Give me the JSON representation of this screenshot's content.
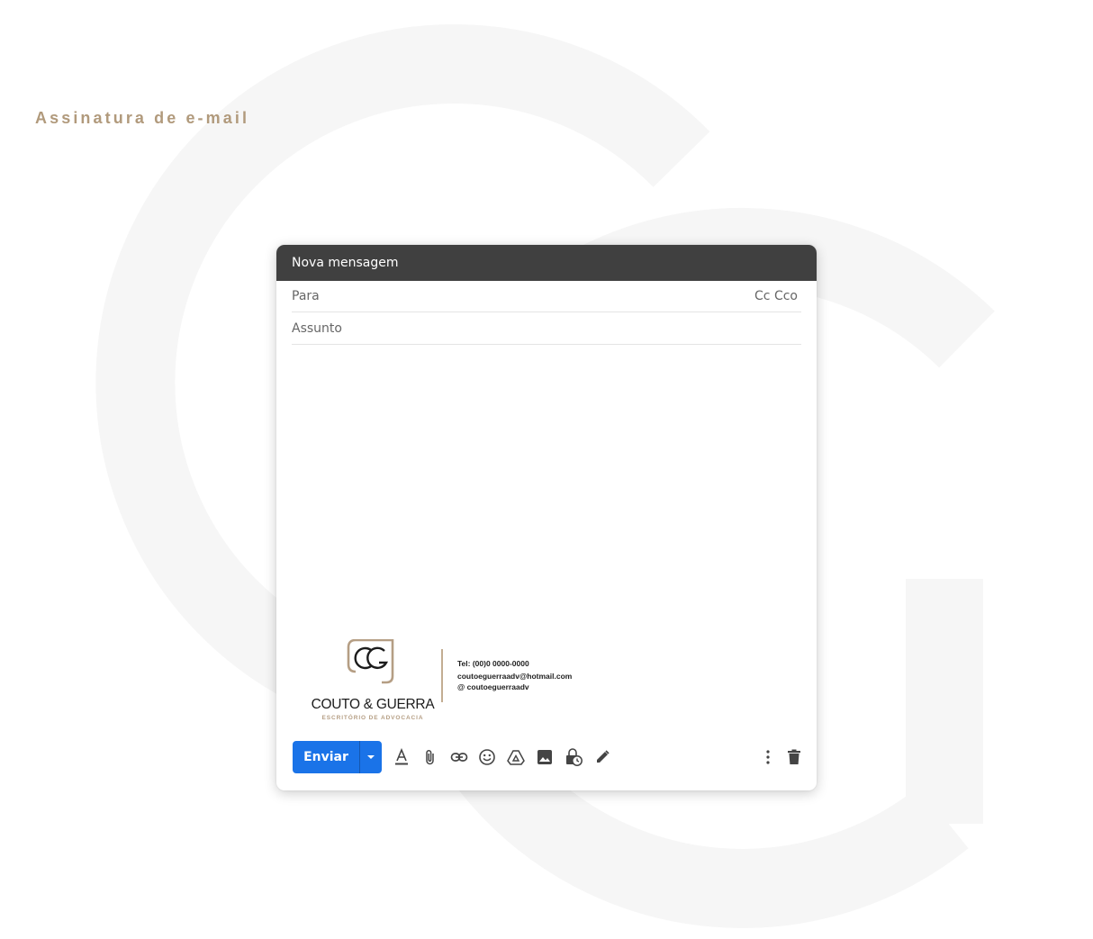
{
  "page": {
    "heading": "Assinatura de e-mail",
    "accent_color": "#b19a7c",
    "watermark_color": "#f6f6f6"
  },
  "compose": {
    "window_title": "Nova mensagem",
    "to_label": "Para",
    "cc_label": "Cc",
    "bcc_label": "Cco",
    "subject_label": "Assunto",
    "header_color": "#404040"
  },
  "signature": {
    "logo_monogram": "CG",
    "brand_name": "COUTO & GUERRA",
    "tagline": "ESCRITÓRIO DE ADVOCACIA",
    "tel": "Tel: (00)0 0000-0000",
    "email": "coutoeguerraadv@hotmail.com",
    "instagram": "@ coutoeguerraadv",
    "brand_gold": "#b59e84"
  },
  "toolbar": {
    "send_label": "Enviar",
    "send_color": "#1a73e8",
    "icons": [
      "format-text-icon",
      "attach-icon",
      "link-icon",
      "emoji-icon",
      "drive-icon",
      "image-icon",
      "confidential-mode-icon",
      "signature-pen-icon",
      "more-options-icon",
      "delete-icon"
    ]
  }
}
